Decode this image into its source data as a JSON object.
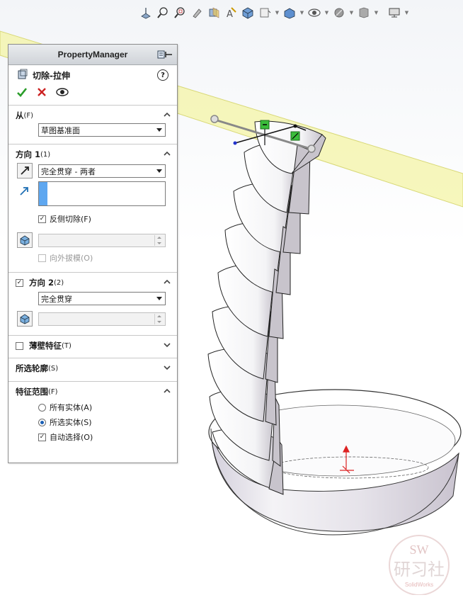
{
  "colors": {
    "accent": "#1a5fb4",
    "ok_green": "#2a9d2a",
    "cancel_red": "#cc2222",
    "plane_fill": "#f3f3a0",
    "selection_blue": "#5ea7f0"
  },
  "toolbar": {
    "icons": [
      "view-orientation-icon",
      "zoom-to-fit-icon",
      "zoom-to-area-icon",
      "previous-view-icon",
      "section-view-icon",
      "dynamic-annotation-icon",
      "view-orientation-cube-icon",
      "display-style-icon",
      "hide-show-items-icon",
      "edit-appearance-icon",
      "apply-scene-icon",
      "view-settings-icon"
    ]
  },
  "property_manager": {
    "title": "PropertyManager",
    "feature_name": "切除-拉伸",
    "help_label": "?",
    "from": {
      "header": "从",
      "key": "(F)",
      "value": "草图基准面"
    },
    "direction1": {
      "header": "方向 1",
      "key": "(1)",
      "end_condition": "完全贯穿 - 两者",
      "flip_side_label": "反侧切除(F)",
      "flip_side_checked": true,
      "draft_outward_label": "向外拔模(O)",
      "draft_outward_checked": false
    },
    "direction2": {
      "header": "方向 2",
      "key": "(2)",
      "enabled": true,
      "end_condition": "完全贯穿"
    },
    "thin_feature": {
      "header": "薄壁特征",
      "key": "(T)",
      "enabled": false
    },
    "selected_contours": {
      "header": "所选轮廓",
      "key": "(S)"
    },
    "feature_scope": {
      "header": "特征范围",
      "key": "(F)",
      "all_bodies_label": "所有实体(A)",
      "selected_bodies_label": "所选实体(S)",
      "selected": "selected_bodies",
      "auto_select_label": "自动选择(O)",
      "auto_select_checked": true
    }
  },
  "watermark": {
    "line1": "SW",
    "line2": "研习社",
    "line3": "SolidWorks"
  }
}
